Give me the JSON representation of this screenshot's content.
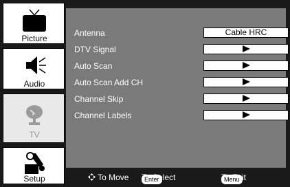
{
  "sidebar": {
    "tabs": [
      {
        "label": "Picture",
        "icon": "tv-icon"
      },
      {
        "label": "Audio",
        "icon": "speaker-icon"
      },
      {
        "label": "TV",
        "icon": "satellite-dish-icon"
      },
      {
        "label": "Setup",
        "icon": "tools-icon"
      }
    ]
  },
  "menu": {
    "items": [
      {
        "label": "Antenna",
        "value": "Cable HRC"
      },
      {
        "label": "DTV Signal",
        "value": ""
      },
      {
        "label": "Auto Scan",
        "value": ""
      },
      {
        "label": "Auto Scan Add CH",
        "value": ""
      },
      {
        "label": "Channel Skip",
        "value": ""
      },
      {
        "label": "Channel Labels",
        "value": ""
      }
    ]
  },
  "footer": {
    "move_text": "To Move",
    "enter_key": "Enter",
    "select_text": "To Select",
    "menu_key": "Menu",
    "exit_text": "To Exit"
  },
  "colors": {
    "frame": "#1a1a1a",
    "panel": "#7a7a7a",
    "text": "#ffffff"
  }
}
